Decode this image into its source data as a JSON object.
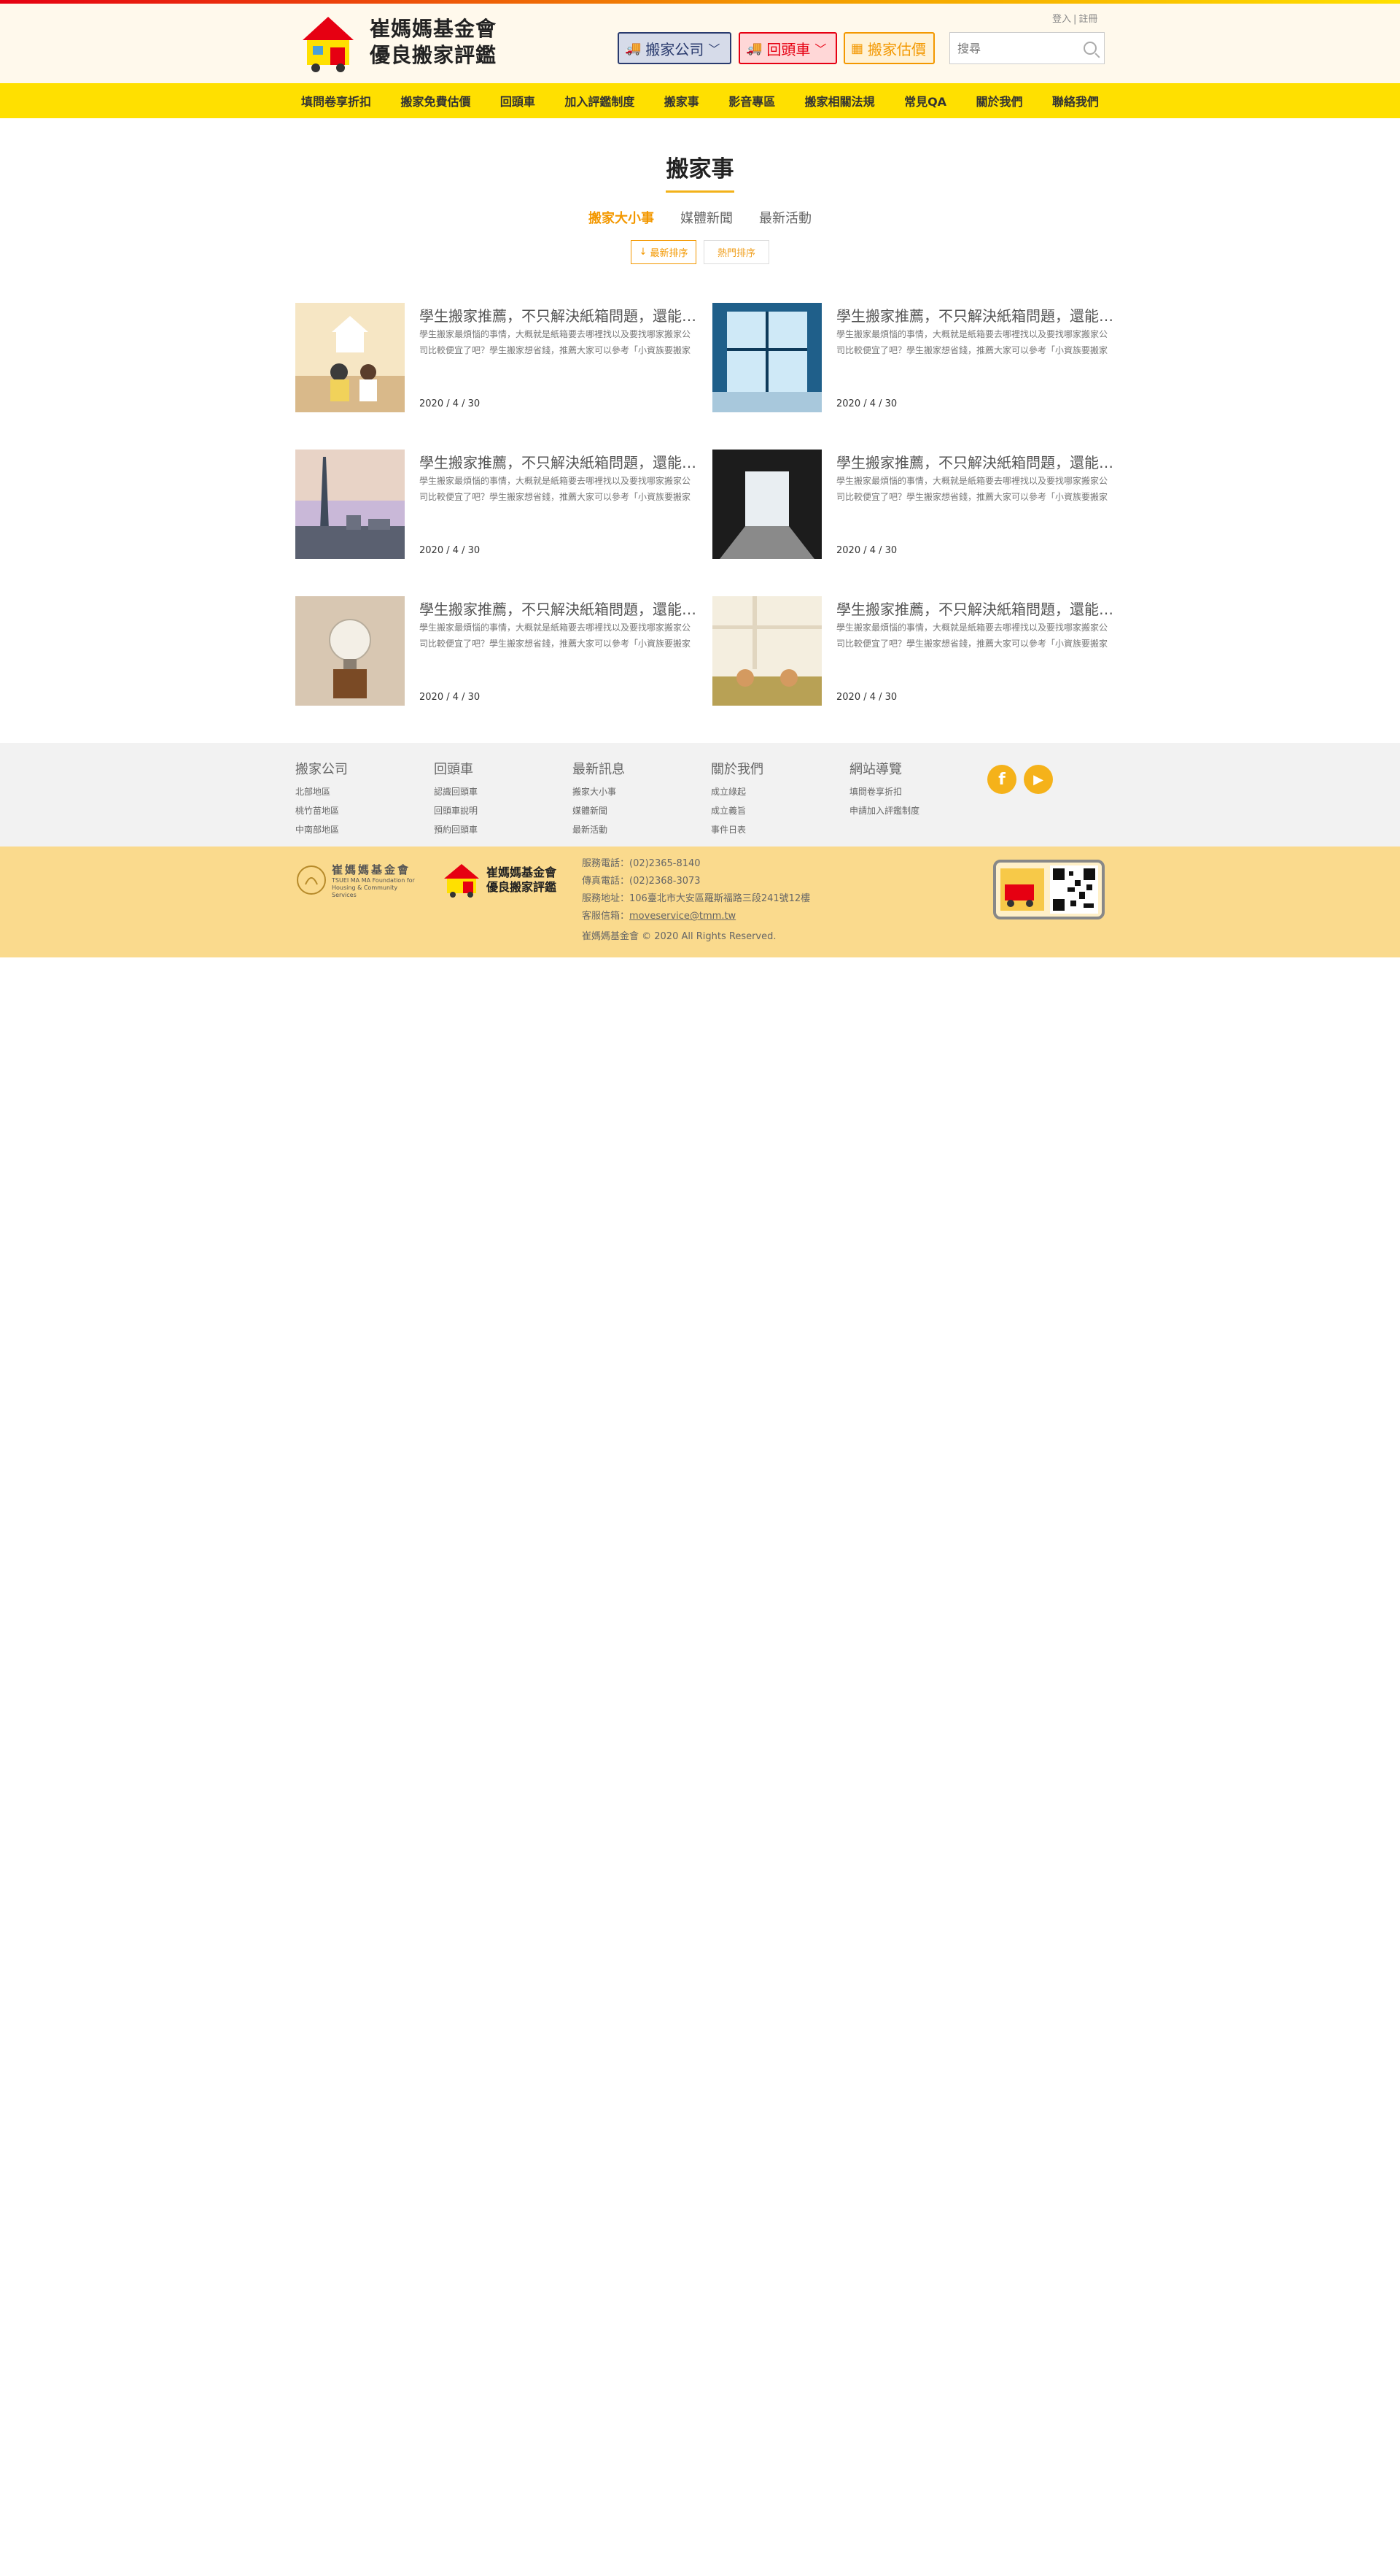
{
  "header": {
    "login": "登入",
    "register": "註冊",
    "logo_line1": "崔媽媽基金會",
    "logo_line2": "優良搬家評鑑",
    "btn_company": "搬家公司",
    "btn_return": "回頭車",
    "btn_price": "搬家估價",
    "search_placeholder": "搜尋"
  },
  "nav": [
    "填問卷享折扣",
    "搬家免費估價",
    "回頭車",
    "加入評鑑制度",
    "搬家事",
    "影音專區",
    "搬家相關法規",
    "常見QA",
    "關於我們",
    "聯絡我們"
  ],
  "page": {
    "title": "搬家事",
    "tabs": [
      "搬家大小事",
      "媒體新聞",
      "最新活動"
    ],
    "sort_new": "最新排序",
    "sort_hot": "熱門排序"
  },
  "articles": [
    {
      "title": "學生搬家推薦，不只解決紙箱問題，還能找到便宜搬家公司",
      "desc": "學生搬家最煩惱的事情，大概就是紙箱要去哪裡找以及要找哪家搬家公司比較便宜了吧？學生搬家想省錢，推薦大家可以參考「小資族要搬家",
      "date": "2020 / 4 / 30"
    },
    {
      "title": "學生搬家推薦，不只解決紙箱問題，還能找到便宜搬家公司",
      "desc": "學生搬家最煩惱的事情，大概就是紙箱要去哪裡找以及要找哪家搬家公司比較便宜了吧？學生搬家想省錢，推薦大家可以參考「小資族要搬家",
      "date": "2020 / 4 / 30"
    },
    {
      "title": "學生搬家推薦，不只解決紙箱問題，還能找到便宜搬家公司",
      "desc": "學生搬家最煩惱的事情，大概就是紙箱要去哪裡找以及要找哪家搬家公司比較便宜了吧？學生搬家想省錢，推薦大家可以參考「小資族要搬家",
      "date": "2020 / 4 / 30"
    },
    {
      "title": "學生搬家推薦，不只解決紙箱問題，還能找到便宜搬家公司",
      "desc": "學生搬家最煩惱的事情，大概就是紙箱要去哪裡找以及要找哪家搬家公司比較便宜了吧？學生搬家想省錢，推薦大家可以參考「小資族要搬家",
      "date": "2020 / 4 / 30"
    },
    {
      "title": "學生搬家推薦，不只解決紙箱問題，還能找到便宜搬家公司",
      "desc": "學生搬家最煩惱的事情，大概就是紙箱要去哪裡找以及要找哪家搬家公司比較便宜了吧？學生搬家想省錢，推薦大家可以參考「小資族要搬家",
      "date": "2020 / 4 / 30"
    },
    {
      "title": "學生搬家推薦，不只解決紙箱問題，還能找到便宜搬家公司",
      "desc": "學生搬家最煩惱的事情，大概就是紙箱要去哪裡找以及要找哪家搬家公司比較便宜了吧？學生搬家想省錢，推薦大家可以參考「小資族要搬家",
      "date": "2020 / 4 / 30"
    }
  ],
  "footer": {
    "cols": [
      {
        "title": "搬家公司",
        "items": [
          "北部地區",
          "桃竹苗地區",
          "中南部地區"
        ]
      },
      {
        "title": "回頭車",
        "items": [
          "認識回頭車",
          "回頭車說明",
          "預約回頭車"
        ]
      },
      {
        "title": "最新訊息",
        "items": [
          "搬家大小事",
          "媒體新聞",
          "最新活動"
        ]
      },
      {
        "title": "關於我們",
        "items": [
          "成立綠起",
          "成立義旨",
          "事件日表"
        ]
      },
      {
        "title": "網站導覽",
        "items": [
          "填問卷享折扣",
          "申請加入評鑑制度"
        ]
      }
    ],
    "foundation_name": "崔媽媽基金會",
    "foundation_en": "TSUEI MA MA Foundation for Housing & Community Services",
    "brand_line1": "崔媽媽基金會",
    "brand_line2": "優良搬家評鑑",
    "phone": "服務電話：(02)2365-8140",
    "fax": "傳真電話：(02)2368-3073",
    "address": "服務地址：106臺北市大安區羅斯福路三段241號12樓",
    "email_label": "客服信箱：",
    "email": "moveservice@tmm.tw",
    "copyright": "崔媽媽基金會 © 2020 All Rights Reserved."
  }
}
